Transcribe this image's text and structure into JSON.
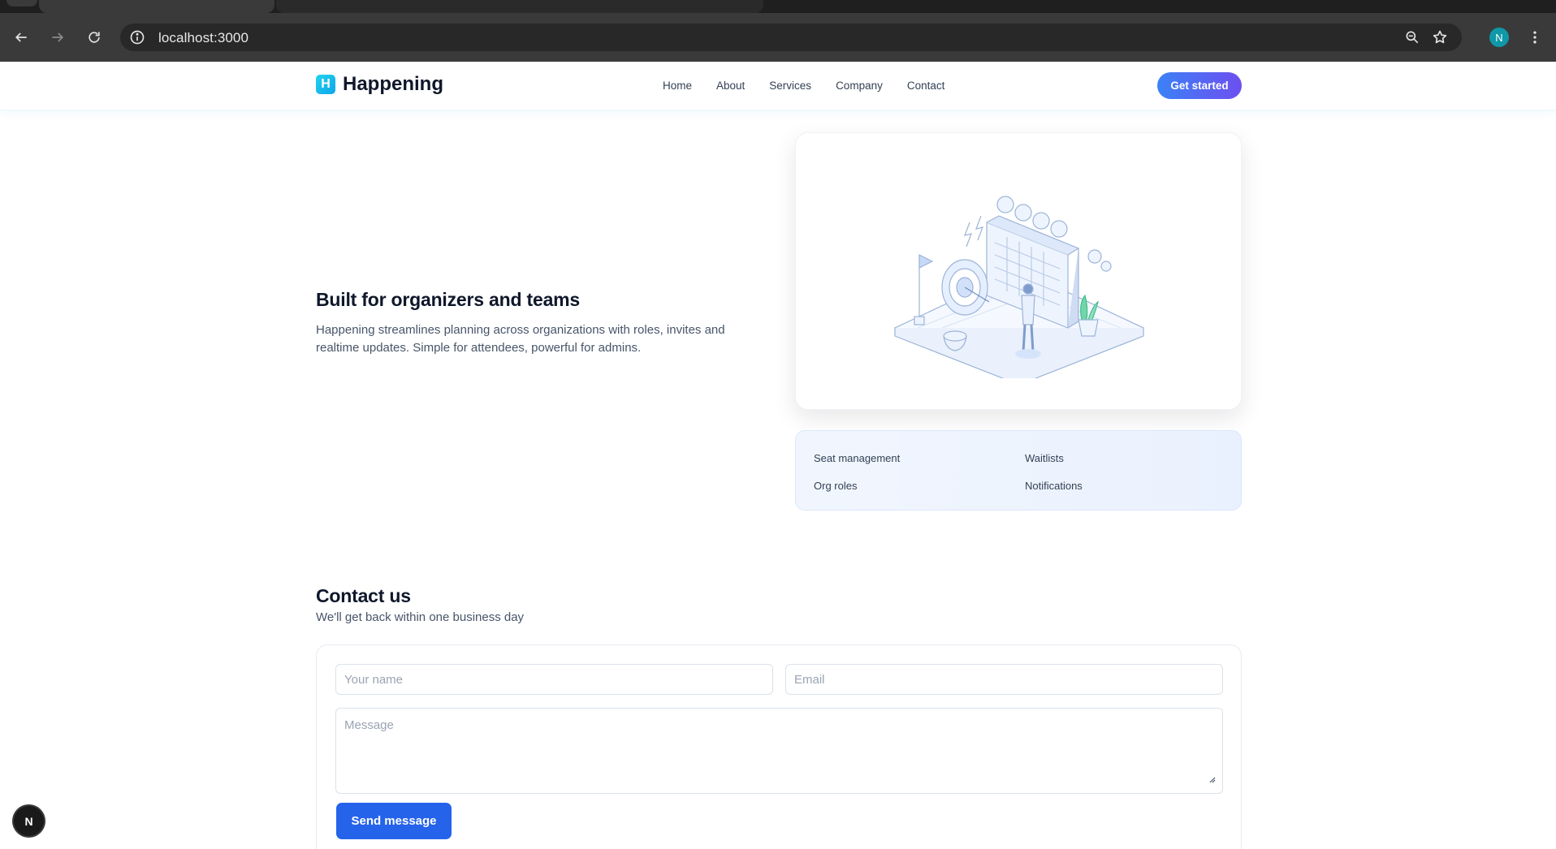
{
  "browser": {
    "url": "localhost:3000",
    "profile_initial": "N"
  },
  "site": {
    "brand_mark": "H",
    "brand_name": "Happening",
    "nav": [
      "Home",
      "About",
      "Services",
      "Company",
      "Contact"
    ],
    "cta_label": "Get started"
  },
  "feature": {
    "title": "Built for organizers and teams",
    "description": "Happening streamlines planning across organizations with roles, invites and realtime updates. Simple for attendees, powerful for admins.",
    "highlights": [
      "Seat management",
      "Waitlists",
      "Org roles",
      "Notifications"
    ]
  },
  "contact": {
    "title": "Contact us",
    "subtitle": "We'll get back within one business day",
    "name_placeholder": "Your name",
    "email_placeholder": "Email",
    "message_placeholder": "Message",
    "submit_label": "Send message"
  },
  "dev_badge": "N",
  "colors": {
    "brand_gradient_start": "#22d3ee",
    "cta_gradient_start": "#3b82f6",
    "cta_gradient_end": "#6d4ff0",
    "submit": "#2563eb",
    "highlights_bg": "#eef4fe"
  }
}
